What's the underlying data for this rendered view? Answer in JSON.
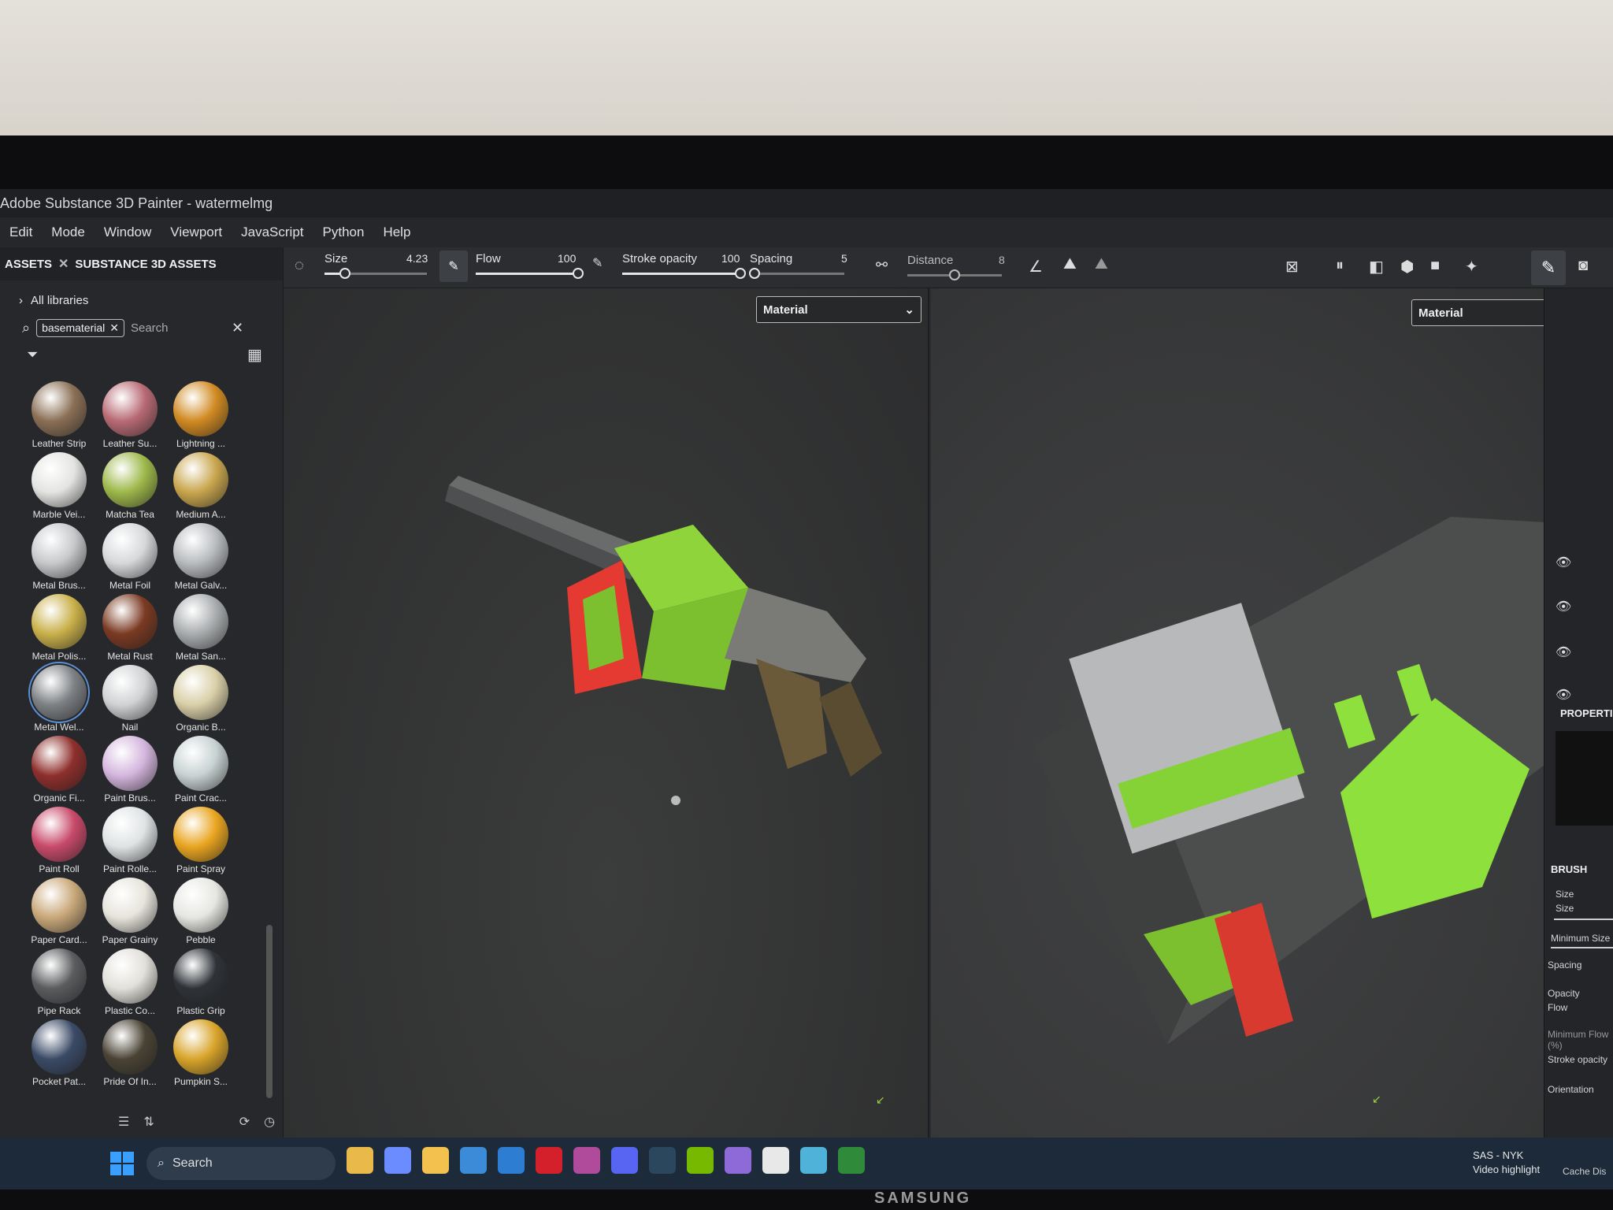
{
  "window": {
    "title": "Adobe Substance 3D Painter - watermelmg"
  },
  "menu": [
    "Edit",
    "Mode",
    "Window",
    "Viewport",
    "JavaScript",
    "Python",
    "Help"
  ],
  "assets": {
    "tab_assets": "ASSETS",
    "tab_substance": "SUBSTANCE 3D ASSETS",
    "libraries": "All libraries",
    "filter_chip": "basematerial",
    "search_placeholder": "Search",
    "materials": [
      {
        "label": "Leather Strip",
        "color": "#8a6f55"
      },
      {
        "label": "Leather Su...",
        "color": "#b86a74"
      },
      {
        "label": "Lightning ...",
        "color": "#d08a22"
      },
      {
        "label": "Marble Vei...",
        "color": "#e4e4e2"
      },
      {
        "label": "Matcha Tea",
        "color": "#9db84a"
      },
      {
        "label": "Medium A...",
        "color": "#c9a64e"
      },
      {
        "label": "Metal Brus...",
        "color": "#c7c9cb"
      },
      {
        "label": "Metal Foil",
        "color": "#d6d8da"
      },
      {
        "label": "Metal Galv...",
        "color": "#b9bcbf"
      },
      {
        "label": "Metal Polis...",
        "color": "#c9b04a"
      },
      {
        "label": "Metal Rust",
        "color": "#7a3a22"
      },
      {
        "label": "Metal San...",
        "color": "#a9acae"
      },
      {
        "label": "Metal Wel...",
        "color": "#7d8084",
        "selected": true
      },
      {
        "label": "Nail",
        "color": "#d0d2d3"
      },
      {
        "label": "Organic B...",
        "color": "#d9cfa8"
      },
      {
        "label": "Organic Fi...",
        "color": "#8e2f2c"
      },
      {
        "label": "Paint Brus...",
        "color": "#d4b5dd"
      },
      {
        "label": "Paint Crac...",
        "color": "#c8d2d2"
      },
      {
        "label": "Paint Roll",
        "color": "#c84a6a"
      },
      {
        "label": "Paint Rolle...",
        "color": "#dfe3e4"
      },
      {
        "label": "Paint Spray",
        "color": "#e9a520"
      },
      {
        "label": "Paper Card...",
        "color": "#c9a87a"
      },
      {
        "label": "Paper Grainy",
        "color": "#e7e4dc"
      },
      {
        "label": "Pebble",
        "color": "#e6e6e2"
      },
      {
        "label": "Pipe Rack",
        "color": "#5a5c5e"
      },
      {
        "label": "Plastic Co...",
        "color": "#e2e0da"
      },
      {
        "label": "Plastic Grip",
        "color": "#2f3338"
      },
      {
        "label": "Pocket Pat...",
        "color": "#3a4a66"
      },
      {
        "label": "Pride Of In...",
        "color": "#4a4335"
      },
      {
        "label": "Pumpkin S...",
        "color": "#d8a42a"
      }
    ]
  },
  "toolbar": {
    "size_label": "Size",
    "size_value": "4.23",
    "size_pct": 0.2,
    "flow_label": "Flow",
    "flow_value": "100",
    "flow_pct": 1.0,
    "opacity_label": "Stroke opacity",
    "opacity_value": "100",
    "opacity_pct": 1.0,
    "spacing_label": "Spacing",
    "spacing_value": "5",
    "spacing_pct": 0.05,
    "distance_label": "Distance",
    "distance_value": "8",
    "distance_pct": 0.5
  },
  "viewport3d": {
    "mode": "Material"
  },
  "viewport2d": {
    "mode": "Material"
  },
  "properties": {
    "title": "PROPERTI",
    "brush": "BRUSH",
    "size_section": "Size",
    "size": "Size",
    "min_size": "Minimum Size",
    "spacing": "Spacing",
    "opacity_section": "Opacity",
    "flow": "Flow",
    "min_flow": "Minimum Flow (%)",
    "stroke_opacity": "Stroke opacity",
    "orientation": "Orientation"
  },
  "taskbar": {
    "search": "Search",
    "tray_line1": "SAS - NYK",
    "tray_line2": "Video highlight",
    "cache": "Cache Dis"
  },
  "monitor_brand": "SAMSUNG"
}
